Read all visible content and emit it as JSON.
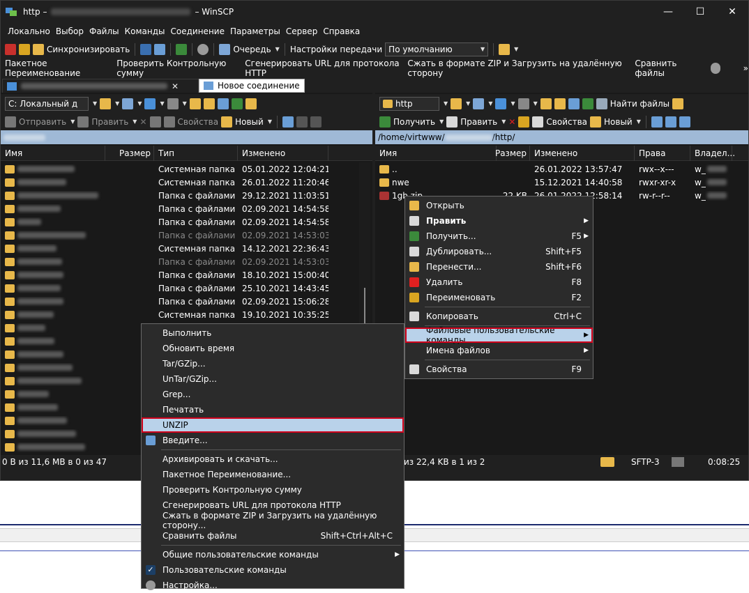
{
  "window": {
    "title_prefix": "http",
    "title_suffix": "WinSCP",
    "min": "—",
    "max": "☐",
    "close": "✕"
  },
  "menu": [
    "Локально",
    "Выбор",
    "Файлы",
    "Команды",
    "Соединение",
    "Параметры",
    "Сервер",
    "Справка"
  ],
  "toolbar1": {
    "sync": "Синхронизировать",
    "queue": "Очередь",
    "transfer_settings": "Настройки передачи",
    "transfer_value": "По умолчанию"
  },
  "toolbar2": [
    "Пакетное Переименование",
    "Проверить Контрольную сумму",
    "Сгенерировать URL для протокола HTTP",
    "Сжать в формате ZIP и Загрузить на удалённую сторону",
    "Сравнить файлы"
  ],
  "tabs": {
    "new": "Новое соединение"
  },
  "left": {
    "drive": "C: Локальный д",
    "send": "Отправить",
    "edit": "Править",
    "props": "Свойства",
    "new": "Новый",
    "cols": [
      "Имя",
      "Размер",
      "Тип",
      "Изменено"
    ],
    "rows": [
      {
        "type": "Системная папка",
        "date": "05.01.2022 12:04:21",
        "dim": false
      },
      {
        "type": "Системная папка",
        "date": "26.01.2022 11:20:46",
        "dim": false
      },
      {
        "type": "Папка с файлами",
        "date": "29.12.2021 11:03:51",
        "dim": false
      },
      {
        "type": "Папка с файлами",
        "date": "02.09.2021 14:54:58",
        "dim": false
      },
      {
        "type": "Папка с файлами",
        "date": "02.09.2021 14:54:58",
        "dim": false
      },
      {
        "type": "Папка с файлами",
        "date": "02.09.2021 14:53:03",
        "dim": true
      },
      {
        "type": "Системная папка",
        "date": "14.12.2021 22:36:43",
        "dim": false
      },
      {
        "type": "Папка с файлами",
        "date": "02.09.2021 14:53:03",
        "dim": true
      },
      {
        "type": "Папка с файлами",
        "date": "18.10.2021 15:00:40",
        "dim": false
      },
      {
        "type": "Папка с файлами",
        "date": "25.10.2021 14:43:45",
        "dim": false
      },
      {
        "type": "Папка с файлами",
        "date": "02.09.2021 15:06:28",
        "dim": false
      },
      {
        "type": "Системная папка",
        "date": "19.10.2021 10:35:25",
        "dim": false
      }
    ],
    "status": "0 B из 11,6 MB в 0 из 47"
  },
  "right": {
    "dir": "http",
    "find": "Найти файлы",
    "get": "Получить",
    "edit": "Править",
    "props": "Свойства",
    "new": "Новый",
    "path_prefix": "/home/virtwww/",
    "path_suffix": "/http/",
    "cols": [
      "Имя",
      "Размер",
      "Изменено",
      "Права",
      "Владел..."
    ],
    "rows": [
      {
        "name": "..",
        "size": "",
        "date": "26.01.2022 13:57:47",
        "rights": "rwx--x---",
        "owner": "w_"
      },
      {
        "name": "nwe",
        "size": "",
        "date": "15.12.2021 14:40:58",
        "rights": "rwxr-xr-x",
        "owner": "w_"
      },
      {
        "name": "1gb.zip",
        "size": "22 KB",
        "date": "26.01.2022 12:58:14",
        "rights": "rw-r--r--",
        "owner": "w_"
      }
    ],
    "status": "из 22,4 KB в 1 из 2",
    "sftp": "SFTP-3",
    "time": "0:08:25"
  },
  "context_menu": [
    {
      "label": "Открыть",
      "sc": ""
    },
    {
      "label": "Править",
      "sc": "",
      "bold": true,
      "sub": true
    },
    {
      "label": "Получить...",
      "sc": "F5",
      "sub": true
    },
    {
      "label": "Дублировать...",
      "sc": "Shift+F5"
    },
    {
      "label": "Перенести...",
      "sc": "Shift+F6"
    },
    {
      "label": "Удалить",
      "sc": "F8"
    },
    {
      "label": "Переименовать",
      "sc": "F2"
    },
    {
      "label": "Копировать",
      "sc": "Ctrl+C"
    },
    {
      "label": "Файловые пользовательские команды",
      "sc": "",
      "sub": true
    },
    {
      "label": "Имена файлов",
      "sc": "",
      "sub": true
    },
    {
      "label": "Свойства",
      "sc": "F9"
    }
  ],
  "submenu": [
    {
      "label": "Выполнить",
      "sc": ""
    },
    {
      "label": "Обновить время",
      "sc": ""
    },
    {
      "label": "Tar/GZip...",
      "sc": ""
    },
    {
      "label": "UnTar/GZip...",
      "sc": ""
    },
    {
      "label": "Grep...",
      "sc": ""
    },
    {
      "label": "Печатать",
      "sc": ""
    },
    {
      "label": "UNZIP",
      "sc": ""
    },
    {
      "label": "Введите...",
      "sc": ""
    },
    {
      "label": "Архивировать и скачать...",
      "sc": ""
    },
    {
      "label": "Пакетное Переименование...",
      "sc": ""
    },
    {
      "label": "Проверить Контрольную сумму",
      "sc": ""
    },
    {
      "label": "Сгенерировать URL для протокола HTTP",
      "sc": ""
    },
    {
      "label": "Сжать в формате ZIP и Загрузить на удалённую сторону...",
      "sc": ""
    },
    {
      "label": "Сравнить файлы",
      "sc": "Shift+Ctrl+Alt+C"
    },
    {
      "label": "Общие пользовательские команды",
      "sc": "",
      "sub": true
    },
    {
      "label": "Пользовательские команды",
      "sc": ""
    },
    {
      "label": "Настройка...",
      "sc": ""
    }
  ],
  "colors": {
    "accent": "#b9d2ea",
    "highlight_border": "#d0021b",
    "folder": "#e8b84a"
  }
}
